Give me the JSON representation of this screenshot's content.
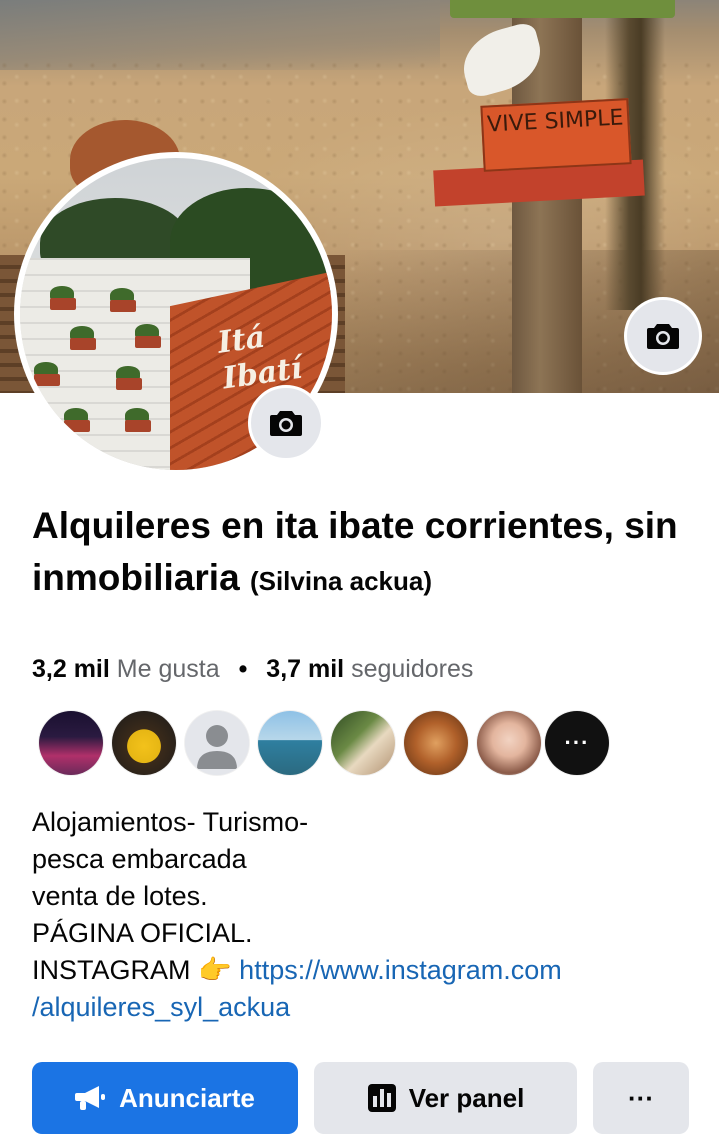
{
  "profile": {
    "name_main": "Alquileres en ita ibate corrientes, sin inmobiliaria",
    "name_sub": "(Silvina ackua)"
  },
  "cover": {
    "sign_text": "VIVE SIMPLE"
  },
  "profile_picture": {
    "board_text": "Itá Ibatí"
  },
  "stats": {
    "likes_count": "3,2 mil",
    "likes_label": "Me gusta",
    "separator": "•",
    "followers_count": "3,7 mil",
    "followers_label": "seguidores"
  },
  "followers_preview": {
    "more_label": "···"
  },
  "bio": {
    "line1": "Alojamientos- Turismo-",
    "line2": "pesca embarcada",
    "line3": "venta de lotes.",
    "line4": "PÁGINA OFICIAL.",
    "line5_prefix": "INSTAGRAM",
    "line5_emoji": "👉",
    "instagram_link_part1": "https://www.instagram.com",
    "instagram_link_part2": "/alquileres_syl_ackua"
  },
  "actions": {
    "advertise_label": "Anunciarte",
    "panel_label": "Ver panel",
    "more_label": "···"
  },
  "colors": {
    "primary_button": "#1b74e4",
    "secondary_button": "#e4e6eb",
    "link": "#1866b4",
    "muted_text": "#65676b"
  },
  "icons": {
    "cover_camera": "camera-icon",
    "profile_camera": "camera-icon",
    "advertise": "megaphone-icon",
    "panel": "bar-chart-icon"
  }
}
